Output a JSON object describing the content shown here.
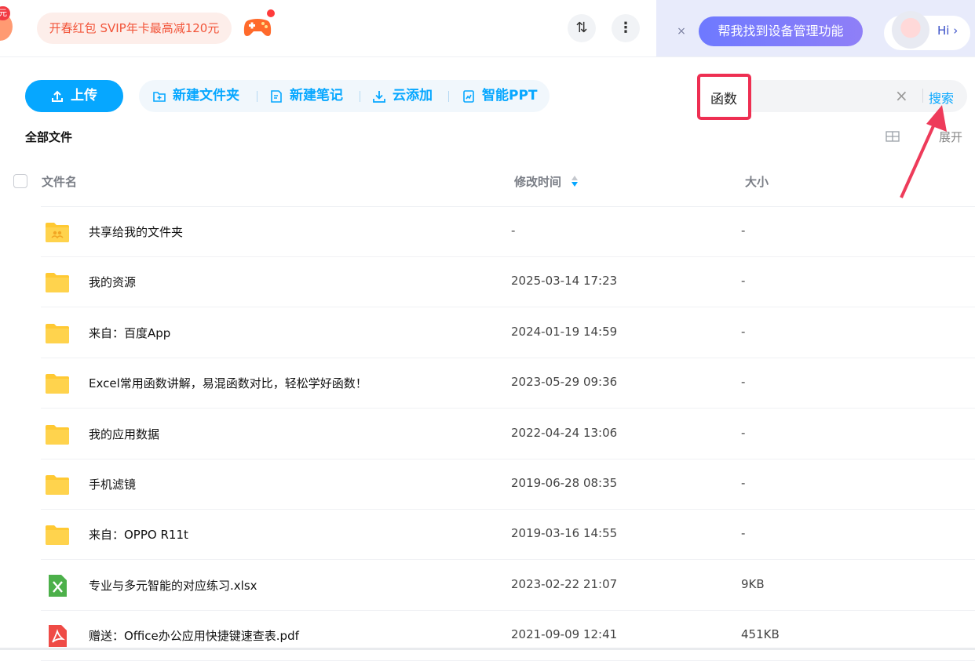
{
  "promo": {
    "badge": "元",
    "text": "开春红包 SVIP年卡最高减120元"
  },
  "assistant": {
    "prompt": "帮我找到设备管理功能",
    "hi": "Hi ›",
    "close": "×"
  },
  "topbar": {
    "sort_icon_glyph": "⇅",
    "more_icon_glyph": "⋮"
  },
  "toolbar": {
    "upload": "上传",
    "new_folder": "新建文件夹",
    "new_note": "新建笔记",
    "cloud_add": "云添加",
    "smart_ppt": "智能PPT"
  },
  "search": {
    "value": "函数",
    "clear": "×",
    "button": "搜索"
  },
  "breadcrumb": "全部文件",
  "view": {
    "expand": "展开"
  },
  "columns": {
    "name": "文件名",
    "modified": "修改时间",
    "size": "大小"
  },
  "files": [
    {
      "name": "共享给我的文件夹",
      "time": "-",
      "size": "-",
      "type": "shared-folder"
    },
    {
      "name": "我的资源",
      "time": "2025-03-14 17:23",
      "size": "-",
      "type": "folder"
    },
    {
      "name": "来自：百度App",
      "time": "2024-01-19 14:59",
      "size": "-",
      "type": "folder"
    },
    {
      "name": "Excel常用函数讲解，易混函数对比，轻松学好函数！",
      "time": "2023-05-29 09:36",
      "size": "-",
      "type": "folder"
    },
    {
      "name": "我的应用数据",
      "time": "2022-04-24 13:06",
      "size": "-",
      "type": "folder"
    },
    {
      "name": "手机滤镜",
      "time": "2019-06-28 08:35",
      "size": "-",
      "type": "folder"
    },
    {
      "name": "来自：OPPO R11t",
      "time": "2019-03-16 14:55",
      "size": "-",
      "type": "folder"
    },
    {
      "name": "专业与多元智能的对应练习.xlsx",
      "time": "2023-02-22 21:07",
      "size": "9KB",
      "type": "xlsx"
    },
    {
      "name": "赠送：Office办公应用快捷键速查表.pdf",
      "time": "2021-09-09 12:41",
      "size": "451KB",
      "type": "pdf"
    }
  ],
  "colors": {
    "accent": "#06a7ff",
    "highlight": "#ee2f52",
    "folder": "#ffc933"
  }
}
